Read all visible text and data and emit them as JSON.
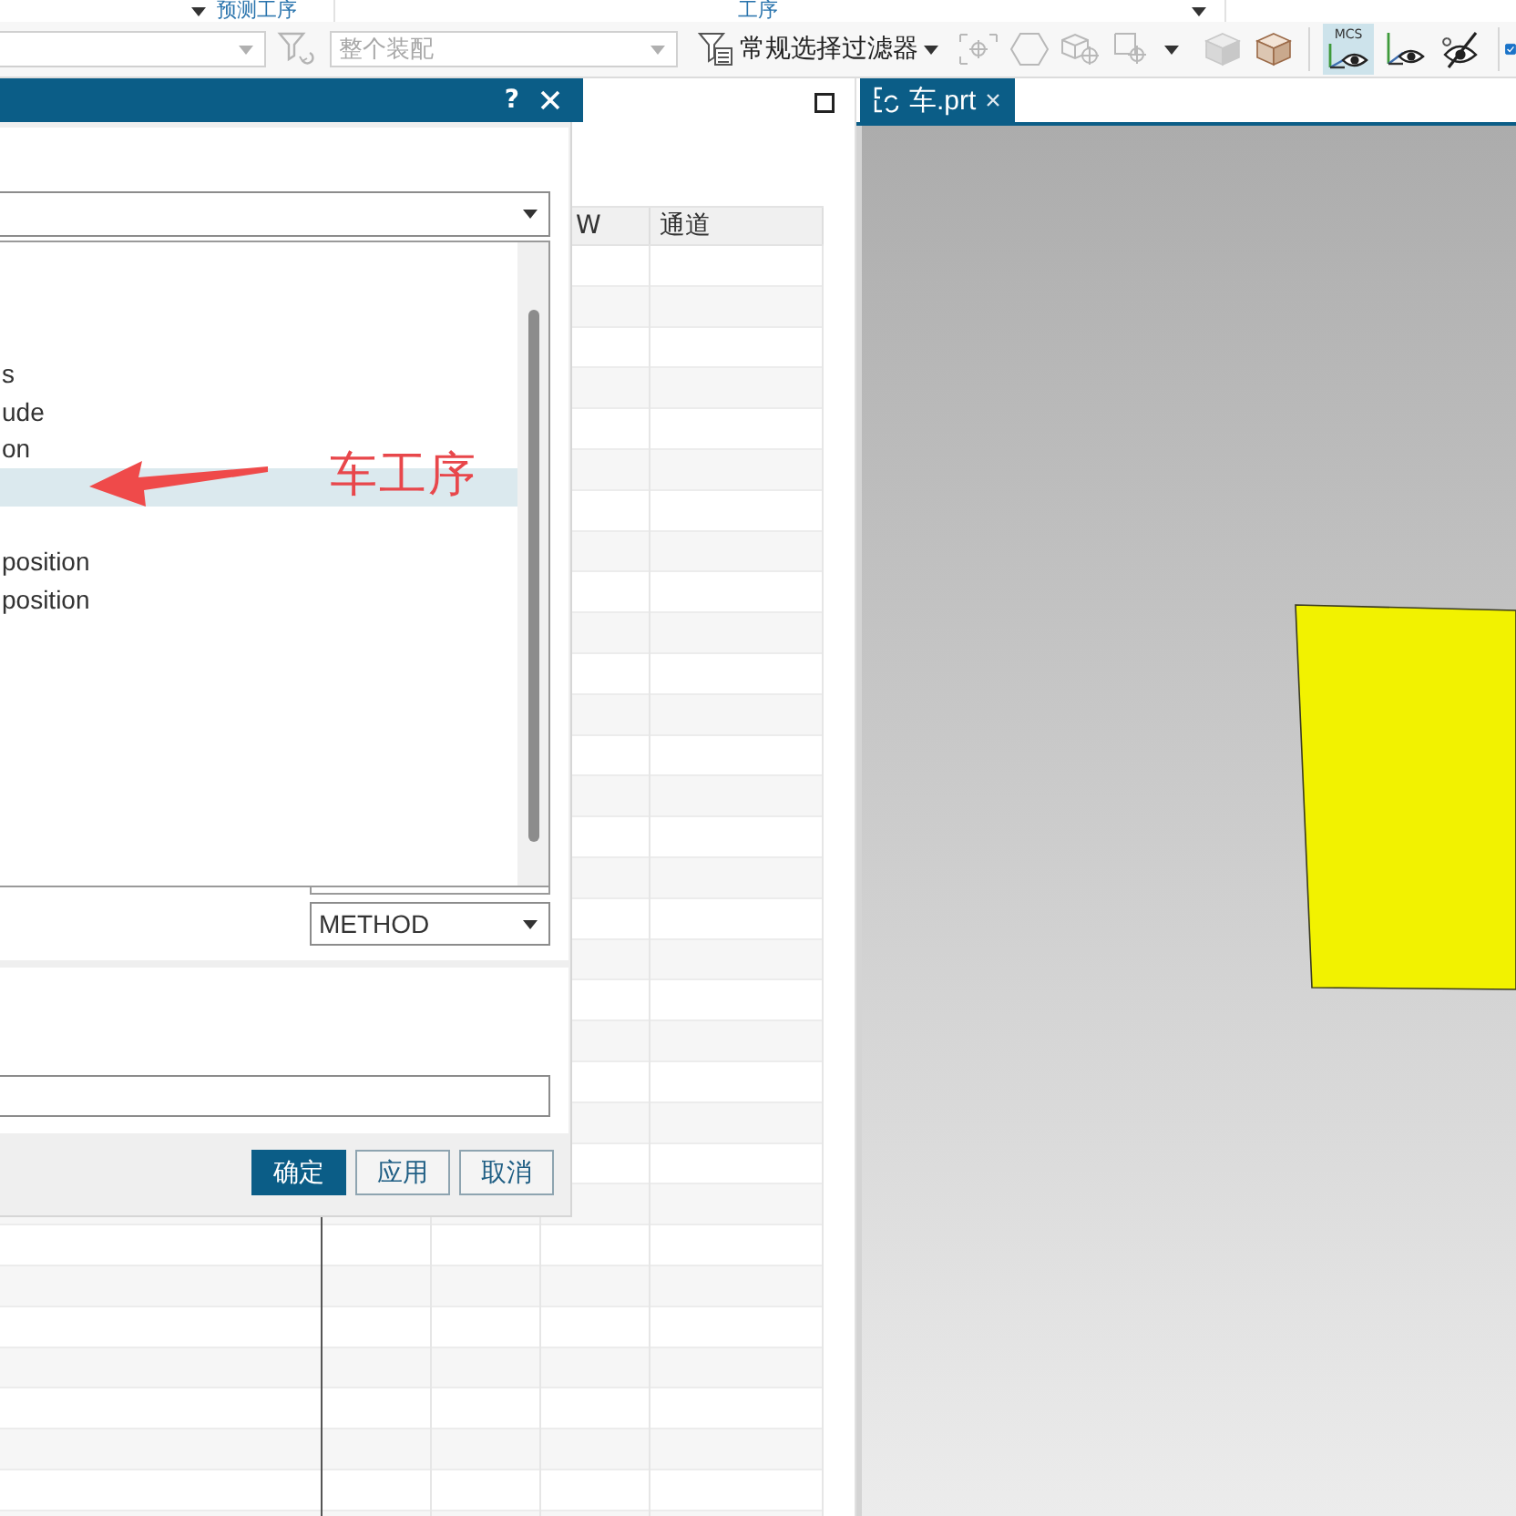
{
  "ribbon_groups": [
    {
      "label": "预测工序"
    },
    {
      "label": "工序"
    }
  ],
  "toolbar": {
    "type_filter": {
      "disabled": true
    },
    "scope": {
      "value": "整个装配",
      "disabled": true
    },
    "selection_filter": {
      "label": "常规选择过滤器"
    },
    "snap_tools": [
      {
        "kind": "point",
        "disabled": true
      },
      {
        "kind": "hexagon",
        "disabled": true
      },
      {
        "kind": "cube_target",
        "disabled": true
      },
      {
        "kind": "square_target",
        "disabled": true
      },
      {
        "kind": "cube",
        "disabled": true
      },
      {
        "kind": "cube",
        "disabled": false
      }
    ],
    "view_toggles": [
      {
        "kind": "mcs",
        "label": "MCS",
        "on": true
      },
      {
        "kind": "axes",
        "on": false
      },
      {
        "kind": "hidden",
        "on": false
      }
    ],
    "checkbox": {
      "checked": true
    }
  },
  "navigator": {
    "table": {
      "columns": [
        {
          "label": "W"
        },
        {
          "label": "通道"
        }
      ]
    }
  },
  "dialog": {
    "help": "?",
    "list": {
      "items": [
        {
          "label": "s",
          "selected": false
        },
        {
          "label": "ude",
          "selected": false
        },
        {
          "label": "on",
          "selected": false
        },
        {
          "selected": true
        },
        {
          "selected": false
        },
        {
          "label": "position",
          "selected": false
        },
        {
          "label": "position",
          "selected": false
        }
      ]
    },
    "method": {
      "value": "METHOD"
    },
    "buttons": [
      {
        "label": "确定",
        "kind": "primary"
      },
      {
        "label": "应用",
        "kind": "secondary"
      },
      {
        "label": "取消",
        "kind": "secondary"
      }
    ]
  },
  "annotation": {
    "label": "车工序"
  },
  "graphics": {
    "tab": {
      "label": "车.prt",
      "selected": true
    }
  }
}
